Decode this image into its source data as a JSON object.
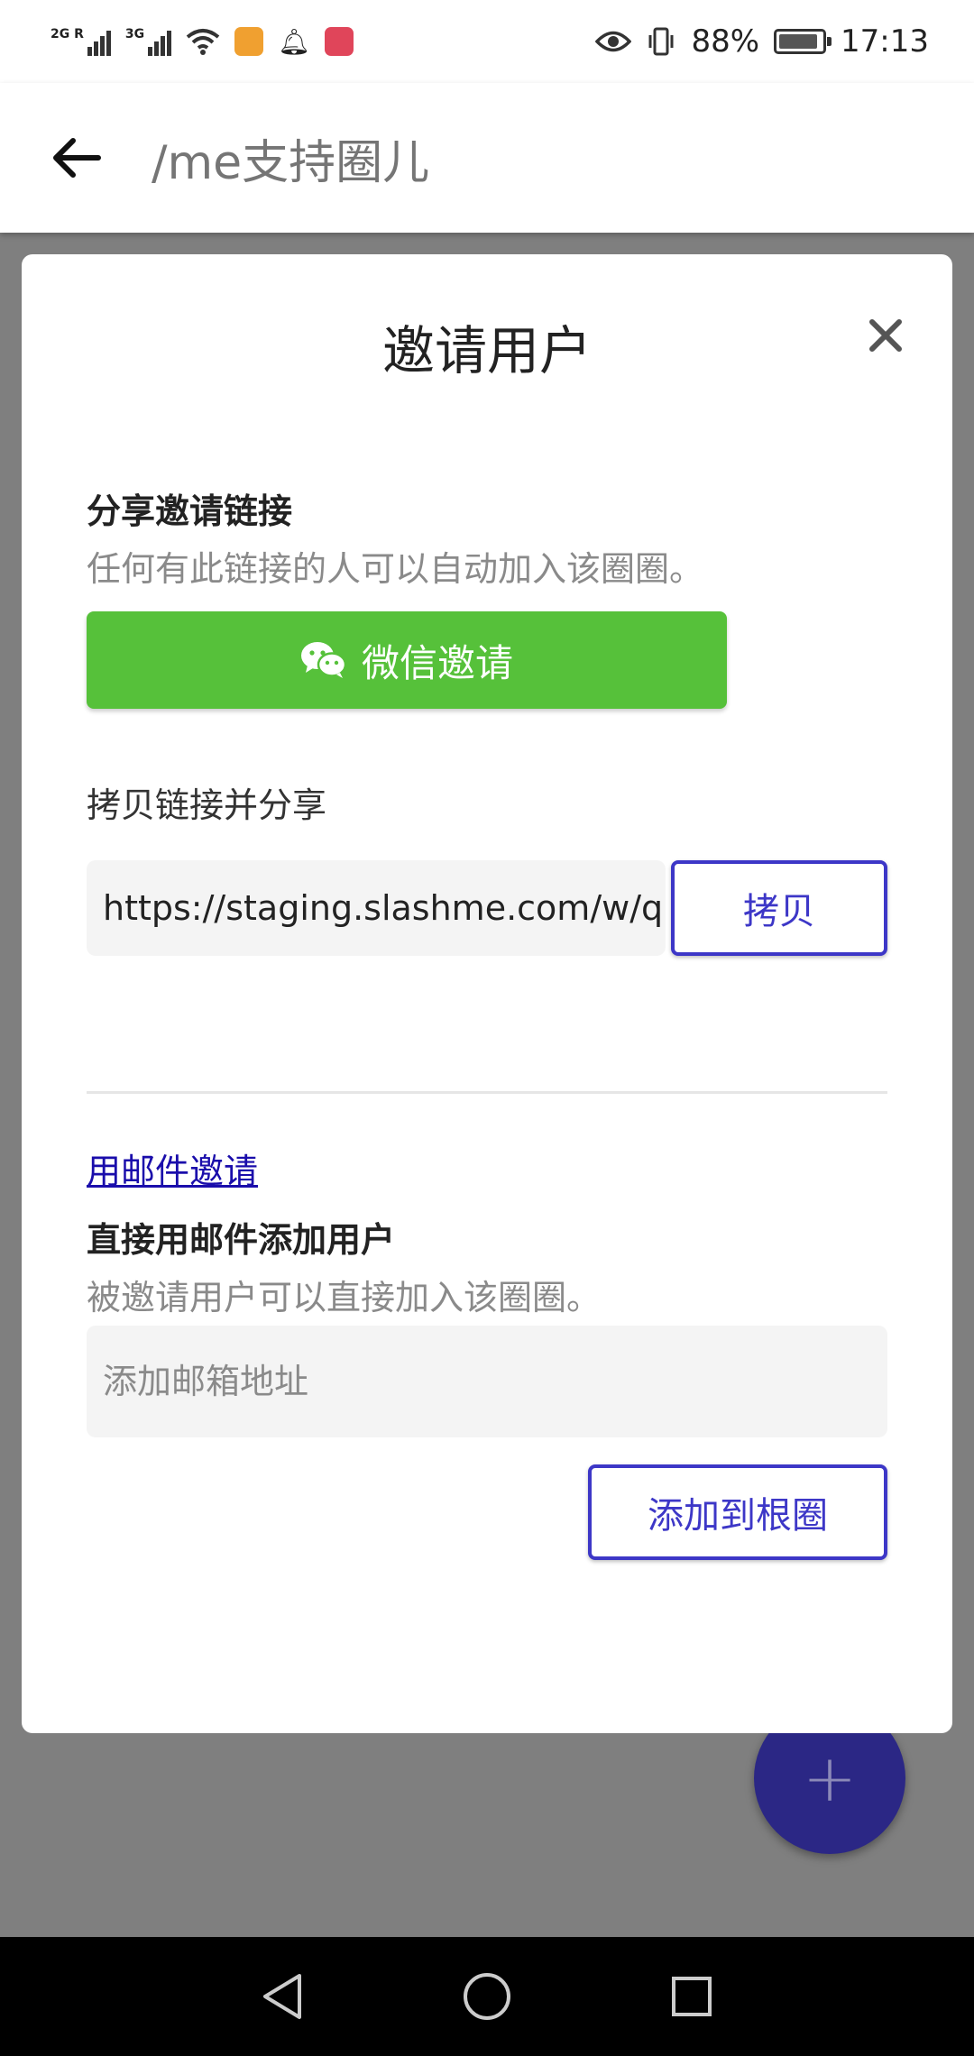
{
  "status_bar": {
    "net1": "2G R",
    "net2": "3G",
    "battery_percent": "88%",
    "time": "17:13"
  },
  "app_bar": {
    "title": "/me支持圈儿"
  },
  "dialog": {
    "title": "邀请用户",
    "share_section": {
      "heading": "分享邀请链接",
      "description": "任何有此链接的人可以自动加入该圈圈。",
      "wechat_button": "微信邀请"
    },
    "copy_section": {
      "label": "拷贝链接并分享",
      "link_value": "https://staging.slashme.com/w/qu",
      "copy_button": "拷贝"
    },
    "email_section": {
      "link_text": "用邮件邀请",
      "heading": "直接用邮件添加用户",
      "description": "被邀请用户可以直接加入该圈圈。",
      "input_placeholder": "添加邮箱地址",
      "add_button": "添加到根圈"
    }
  },
  "fab": {
    "label": "+"
  },
  "colors": {
    "wechat_green": "#56c13a",
    "accent_indigo": "#3d37c7",
    "fab_indigo": "#2b2785",
    "scrim": "#7f7f7f"
  }
}
